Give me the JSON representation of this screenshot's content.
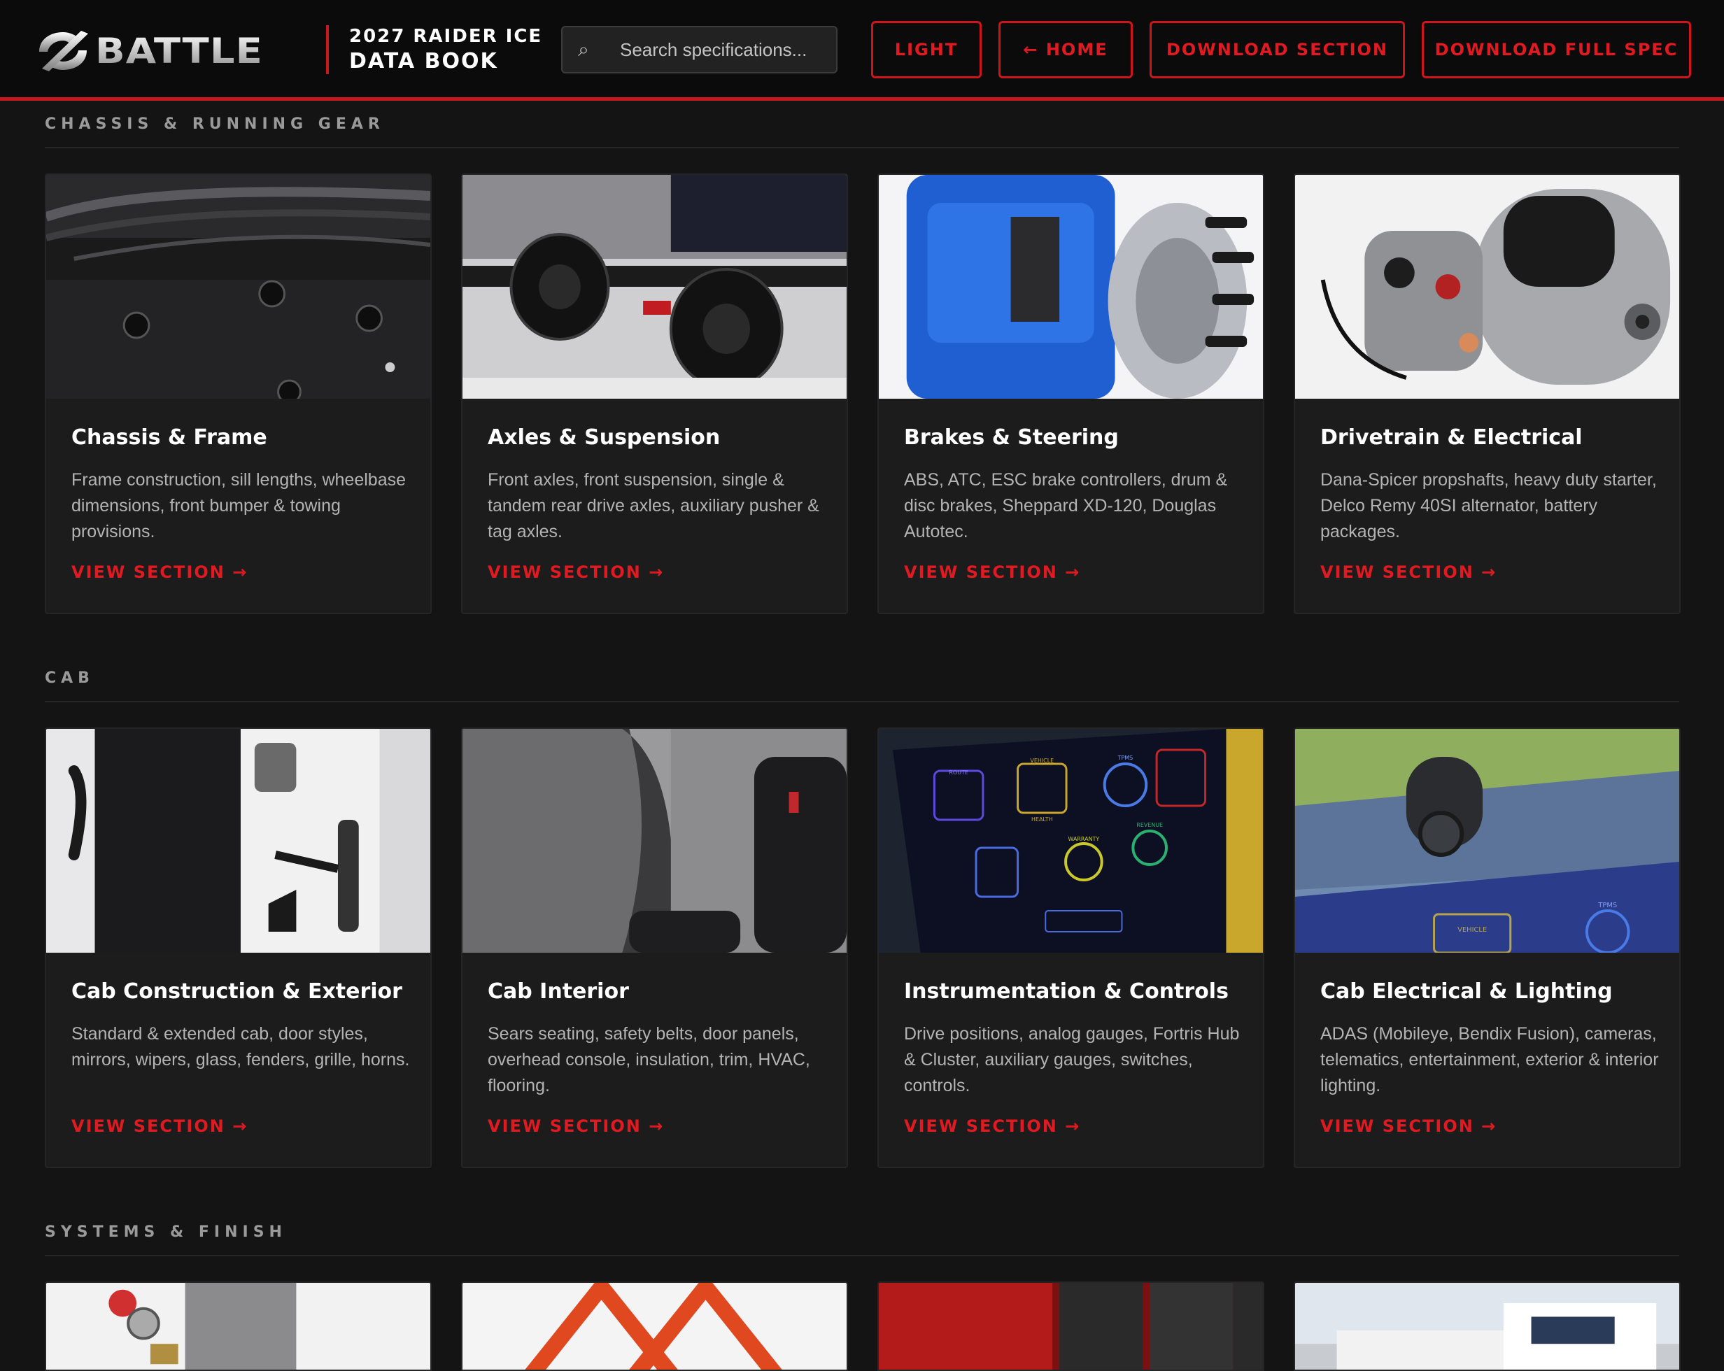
{
  "header": {
    "brand": "BATTLE",
    "book_title_line1": "2027 RAIDER ICE",
    "book_title_line2": "DATA BOOK",
    "search_placeholder": "Search specifications...",
    "search_icon": "⌕",
    "buttons": {
      "light": "LIGHT",
      "home": "← HOME",
      "download_section": "DOWNLOAD SECTION",
      "download_full": "DOWNLOAD FULL SPEC"
    }
  },
  "colors": {
    "accent": "#e11a21",
    "background": "#141414",
    "card": "#1c1c1c"
  },
  "sections": [
    {
      "title": "CHASSIS & RUNNING GEAR",
      "cards": [
        {
          "title": "Chassis & Frame",
          "desc": "Frame construction, sill lengths, wheelbase dimensions, front bumper & towing provisions.",
          "link": "VIEW SECTION →"
        },
        {
          "title": "Axles & Suspension",
          "desc": "Front axles, front suspension, single & tandem rear drive axles, auxiliary pusher & tag axles.",
          "link": "VIEW SECTION →"
        },
        {
          "title": "Brakes & Steering",
          "desc": "ABS, ATC, ESC brake controllers, drum & disc brakes, Sheppard XD-120, Douglas Autotec.",
          "link": "VIEW SECTION →"
        },
        {
          "title": "Drivetrain & Electrical",
          "desc": "Dana-Spicer propshafts, heavy duty starter, Delco Remy 40SI alternator, battery packages.",
          "link": "VIEW SECTION →"
        }
      ]
    },
    {
      "title": "CAB",
      "cards": [
        {
          "title": "Cab Construction & Exterior",
          "desc": "Standard & extended cab, door styles, mirrors, wipers, glass, fenders, grille, horns.",
          "link": "VIEW SECTION →"
        },
        {
          "title": "Cab Interior",
          "desc": "Sears seating, safety belts, door panels, overhead console, insulation, trim, HVAC, flooring.",
          "link": "VIEW SECTION →"
        },
        {
          "title": "Instrumentation & Controls",
          "desc": "Drive positions, analog gauges, Fortris Hub & Cluster, auxiliary gauges, switches, controls.",
          "link": "VIEW SECTION →"
        },
        {
          "title": "Cab Electrical & Lighting",
          "desc": "ADAS (Mobileye, Bendix Fusion), cameras, telematics, entertainment, exterior & interior lighting.",
          "link": "VIEW SECTION →"
        }
      ]
    },
    {
      "title": "SYSTEMS & FINISH"
    }
  ],
  "screen_labels": {
    "route": "ROUTE",
    "vehicle": "VEHICLE",
    "tpms": "TPMS",
    "warranty": "WARRANTY",
    "revenue": "REVENUE",
    "health": "HEALTH"
  }
}
